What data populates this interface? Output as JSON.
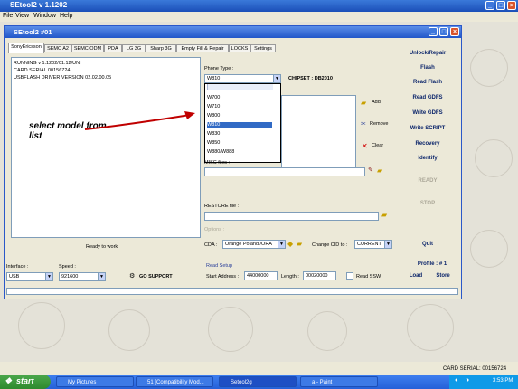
{
  "outer_window": {
    "title": "SEtool2 v 1.1202",
    "menu": [
      "File",
      "View",
      "Window",
      "Help"
    ]
  },
  "inner_window": {
    "title": "SEtool2 #01"
  },
  "tabs": [
    "SonyEricsson",
    "SEMC A2",
    "SEMC ODM",
    "PDA",
    "LG 3G",
    "Sharp 3G",
    "Empty Fill & Repair",
    "LOCKS",
    "Settings"
  ],
  "log": {
    "lines": [
      "RUNNING v 1.1202/01.12/UNI",
      "CARD SERIAL 00156724",
      "USBFLASH DRIVER VERSION 02.02.00.05"
    ],
    "status": "Ready to work"
  },
  "phone_type": {
    "label": "Phone Type :",
    "selected": "W810",
    "chipset": "CHIPSET : DB2010",
    "options": [
      "W660",
      "W700",
      "W710",
      "W800",
      "W810",
      "W830",
      "W850",
      "W880/W888"
    ]
  },
  "buttons": {
    "add": "Add",
    "remove": "Remove",
    "clear": "Clear"
  },
  "misc_files": {
    "label": "MISC files :"
  },
  "restore_file": {
    "label": "RESTORE file :"
  },
  "options": {
    "label": "Options :",
    "cda_label": "CDA :",
    "cda_value": "Orange Poland  /ORA",
    "change_cid_label": "Change CID to :",
    "change_cid_value": "CURRENT"
  },
  "side_buttons": [
    "Unlock/Repair",
    "Flash",
    "Read Flash",
    "Read GDFS",
    "Write GDFS",
    "Write SCRIPT",
    "Recovery",
    "Identify",
    "READY",
    "STOP",
    "Quit"
  ],
  "profile": {
    "label": "Profile : # 1",
    "load": "Load",
    "store": "Store"
  },
  "interface": {
    "label": "Interface :",
    "value": "USB"
  },
  "speed": {
    "label": "Speed :",
    "value": "921600"
  },
  "go_support": "GO SUPPORT",
  "read_setup": {
    "label": "Read Setup",
    "start_label": "Start Address :",
    "start_value": "44000000",
    "length_label": "Length :",
    "length_value": "00020000",
    "read_ssw": "Read SSW"
  },
  "annotation": {
    "text_line1": "select model from",
    "text_line2": "list"
  },
  "statusbar": {
    "card_serial": "CARD SERIAL: 00156724"
  },
  "taskbar": {
    "start": "start",
    "items": [
      "My Pictures",
      "51 [Compatibility Mod...",
      "Setool2g",
      "a - Paint"
    ],
    "clock": "3:53 PM"
  },
  "colors": {
    "title_blue": "#2257c9",
    "selection": "#316ac5",
    "arrow": "#c00000",
    "taskbar": "#2560d8",
    "start": "#2e8a2e"
  }
}
